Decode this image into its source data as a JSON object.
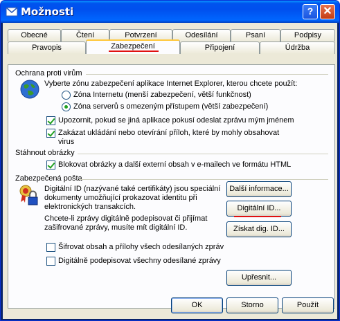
{
  "window": {
    "title": "Možnosti",
    "help_glyph": "?",
    "close_glyph": "✕"
  },
  "tabs_row1": [
    "Obecné",
    "Čtení",
    "Potvrzení",
    "Odesílání",
    "Psaní",
    "Podpisy"
  ],
  "tabs_row2": [
    "Pravopis",
    "Zabezpečení",
    "Připojení",
    "Údržba"
  ],
  "active_tab": "Zabezpečení",
  "virus": {
    "heading": "Ochrana proti virům",
    "zone_prompt": "Vyberte zónu zabezpečení aplikace Internet Explorer, kterou chcete použít:",
    "zone_internet": "Zóna Internetu (menší zabezpečení, větší funkčnost)",
    "zone_restricted": "Zóna serverů s omezeným přístupem (větší zabezpečení)",
    "warn_send": "Upozornit, pokud se jiná aplikace pokusí odeslat zprávu mým jménem",
    "block_attach_1": "Zakázat ukládání nebo otevírání příloh, které by mohly obsahovat",
    "block_attach_2": "virus"
  },
  "images": {
    "heading": "Stáhnout obrázky",
    "block_images": "Blokovat obrázky a další externí obsah v e-mailech ve formátu HTML"
  },
  "secure": {
    "heading": "Zabezpečená pošta",
    "id_desc_1": "Digitální ID (nazývané také certifikáty) jsou speciální",
    "id_desc_2": "dokumenty umožňující prokazovat identitu při",
    "id_desc_3": "elektronických transakcích.",
    "sign_desc_1": "Chcete-li zprávy digitálně podepisovat či přijímat",
    "sign_desc_2": "zašifrované zprávy, musíte mít digitální ID.",
    "more_info": "Další informace...",
    "digital_ids": "Digitální ID...",
    "get_id": "Získat dig. ID...",
    "encrypt_all": "Šifrovat obsah a přílohy všech odesílaných zpráv",
    "sign_all": "Digitálně podepisovat všechny odesílané zprávy",
    "advanced": "Upřesnit..."
  },
  "footer": {
    "ok": "OK",
    "cancel": "Storno",
    "apply": "Použít"
  }
}
